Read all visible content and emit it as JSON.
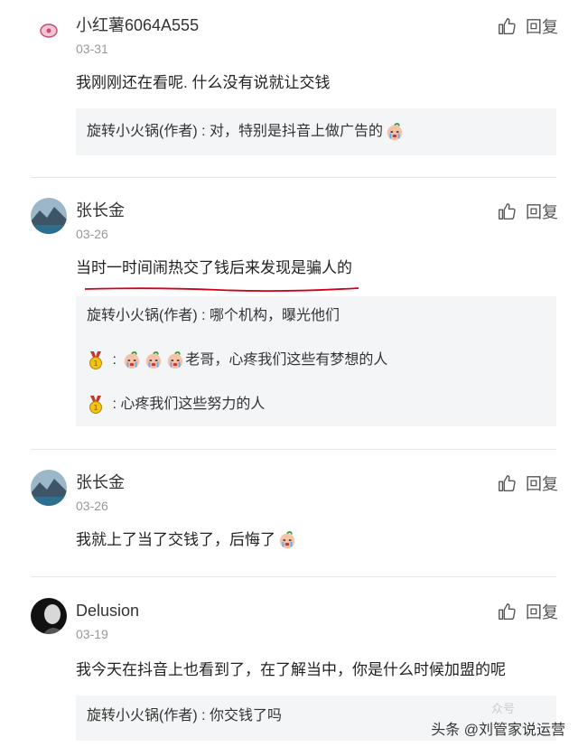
{
  "reply_label": "回复",
  "comments": [
    {
      "username": "小红薯6064A555",
      "date": "03-31",
      "text": "我刚刚还在看呢. 什么没有说就让交钱",
      "replies": [
        {
          "author": "旋转小火锅(作者)",
          "sep": " : ",
          "text": "对，特别是抖音上做广告的"
        }
      ]
    },
    {
      "username": "张长金",
      "date": "03-26",
      "text": "当时一时间闹热交了钱后来发现是骗人的",
      "replies": [
        {
          "author": "旋转小火锅(作者)",
          "sep": " : ",
          "text": "哪个机构，曝光他们"
        },
        {
          "author": "",
          "sep": " : ",
          "text": "老哥，心疼我们这些有梦想的人"
        },
        {
          "author": "",
          "sep": " : ",
          "text": "心疼我们这些努力的人"
        }
      ]
    },
    {
      "username": "张长金",
      "date": "03-26",
      "text": "我就上了当了交钱了，后悔了"
    },
    {
      "username": "Delusion",
      "date": "03-19",
      "text": "我今天在抖音上也看到了，在了解当中，你是什么时候加盟的呢",
      "replies": [
        {
          "author": "旋转小火锅(作者)",
          "sep": " : ",
          "text": "你交钱了吗"
        }
      ]
    }
  ],
  "watermark": {
    "text": "头条 @刘管家说运营",
    "ghost": "众号"
  },
  "icons": [
    "thumb-up-icon",
    "crying-emoji-icon",
    "medal-icon"
  ],
  "colors": {
    "underline": "#d0021b",
    "reply_bg": "#f4f5f6",
    "date": "#999999"
  }
}
